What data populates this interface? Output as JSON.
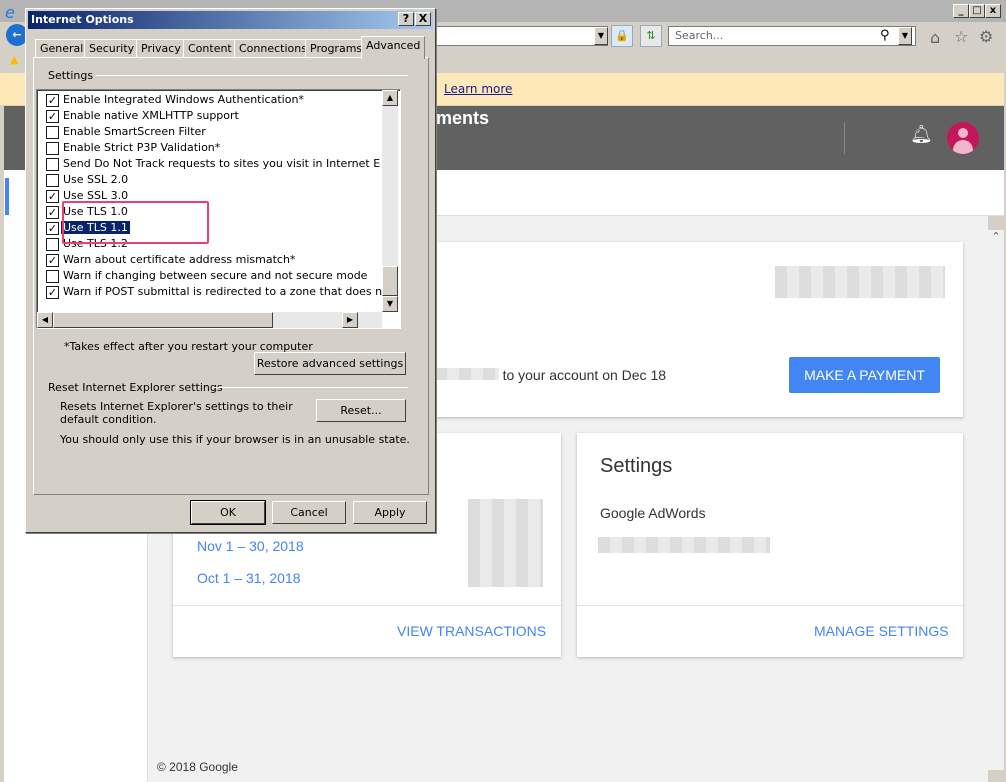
{
  "browser": {
    "search_placeholder": "Search...",
    "banner_link": "Learn more",
    "app_title_fragment": "ments",
    "icons": [
      "ie-logo-icon",
      "back-icon",
      "lock-icon",
      "refresh-icon",
      "search-icon",
      "home-icon",
      "star-icon",
      "gear-icon",
      "bell-icon",
      "avatar-icon",
      "adwords-logo-icon"
    ],
    "accent": "#4285f4",
    "payment_text_start": "d",
    "payment_text_end": "to your account on Dec 18",
    "make_payment": "MAKE A PAYMENT",
    "transactions": {
      "periods": [
        "Nov 1 – 30, 2018",
        "Oct 1 – 31, 2018"
      ],
      "view": "VIEW TRANSACTIONS"
    },
    "settings": {
      "title": "Settings",
      "account": "Google AdWords",
      "manage": "MANAGE SETTINGS"
    },
    "footer": "© 2018 Google"
  },
  "dialog": {
    "title": "Internet Options",
    "help": "?",
    "close": "X",
    "tabs": [
      "General",
      "Security",
      "Privacy",
      "Content",
      "Connections",
      "Programs",
      "Advanced"
    ],
    "active_tab": "Advanced",
    "settings_label": "Settings",
    "items": [
      {
        "label": "Enable Integrated Windows Authentication*",
        "checked": true
      },
      {
        "label": "Enable native XMLHTTP support",
        "checked": true
      },
      {
        "label": "Enable SmartScreen Filter",
        "checked": false
      },
      {
        "label": "Enable Strict P3P Validation*",
        "checked": false
      },
      {
        "label": "Send Do Not Track requests to sites you visit in Internet E",
        "checked": false
      },
      {
        "label": "Use SSL 2.0",
        "checked": false
      },
      {
        "label": "Use SSL 3.0",
        "checked": true
      },
      {
        "label": "Use TLS 1.0",
        "checked": true
      },
      {
        "label": "Use TLS 1.1",
        "checked": true,
        "selected": true
      },
      {
        "label": "Use TLS 1.2",
        "checked": false
      },
      {
        "label": "Warn about certificate address mismatch*",
        "checked": true
      },
      {
        "label": "Warn if changing between secure and not secure mode",
        "checked": false
      },
      {
        "label": "Warn if POST submittal is redirected to a zone that does n",
        "checked": true
      }
    ],
    "note": "*Takes effect after you restart your computer",
    "restore": "Restore advanced settings",
    "reset_group": "Reset Internet Explorer settings",
    "reset_desc": "Resets Internet Explorer's settings to their default condition.",
    "reset": "Reset...",
    "warning": "You should only use this if your browser is in an unusable state.",
    "ok": "OK",
    "cancel": "Cancel",
    "apply": "Apply",
    "highlight_color": "#ec3f7a"
  }
}
